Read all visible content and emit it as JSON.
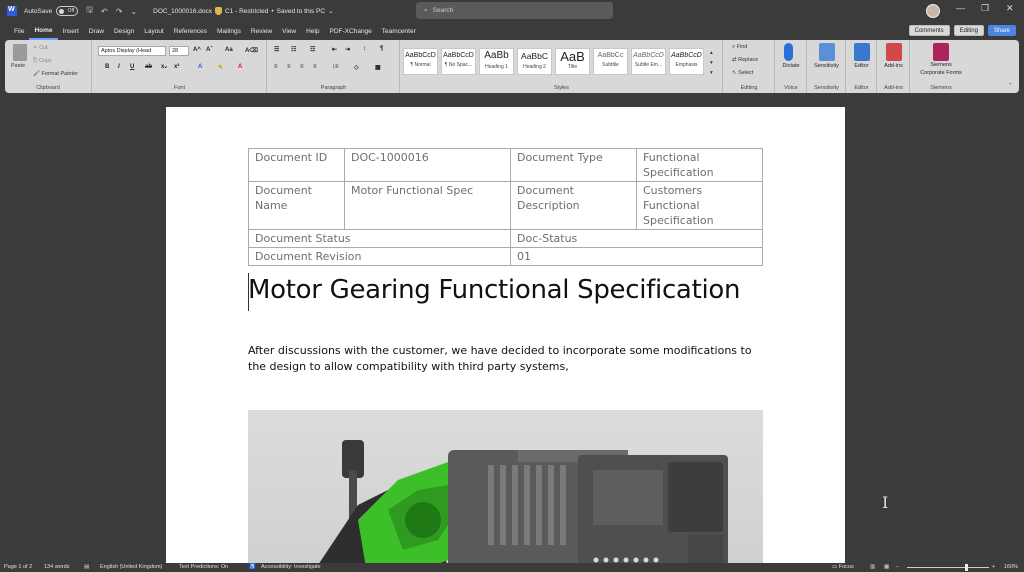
{
  "titlebar": {
    "autosave_label": "AutoSave",
    "autosave_state": "Off",
    "doc_name": "DOC_1000016.docx",
    "sensitivity": "C1 - Restricted",
    "save_status": "Saved to this PC",
    "search_placeholder": "Search"
  },
  "tabs": [
    "File",
    "Home",
    "Insert",
    "Draw",
    "Design",
    "Layout",
    "References",
    "Mailings",
    "Review",
    "View",
    "Help",
    "PDF-XChange",
    "Teamcenter"
  ],
  "ribbon_actions": {
    "comments": "Comments",
    "editing": "Editing",
    "share": "Share"
  },
  "ribbon": {
    "clipboard": {
      "paste": "Paste",
      "cut": "Cut",
      "copy": "Copy",
      "format_painter": "Format Painter",
      "label": "Clipboard"
    },
    "font": {
      "font_name": "Aptos Display (Head",
      "font_size": "28",
      "label": "Font"
    },
    "paragraph": {
      "label": "Paragraph"
    },
    "styles": {
      "label": "Styles",
      "items": [
        {
          "sample": "AaBbCcD",
          "name": "¶ Normal"
        },
        {
          "sample": "AaBbCcD",
          "name": "¶ No Spac..."
        },
        {
          "sample": "AaBb",
          "name": "Heading 1"
        },
        {
          "sample": "AaBbC",
          "name": "Heading 2"
        },
        {
          "sample": "AaB",
          "name": "Title"
        },
        {
          "sample": "AaBbCc",
          "name": "Subtitle"
        },
        {
          "sample": "AaBbCcD",
          "name": "Subtle Em..."
        },
        {
          "sample": "AaBbCcD",
          "name": "Emphasis"
        }
      ]
    },
    "editing": {
      "find": "Find",
      "replace": "Replace",
      "select": "Select",
      "label": "Editing"
    },
    "voice": {
      "dictate": "Dictate",
      "label": "Voice"
    },
    "sensitivity": {
      "button": "Sensitivity",
      "label": "Sensitivity"
    },
    "editor": {
      "button": "Editor",
      "label": "Editor"
    },
    "addins": {
      "button": "Add-ins",
      "label": "Add-ins"
    },
    "siemens": {
      "button_line1": "Siemens",
      "button_line2": "Corporate Forms",
      "label": "Siemens"
    }
  },
  "document": {
    "table": {
      "doc_id_label": "Document ID",
      "doc_id_value": "DOC-1000016",
      "doc_type_label": "Document Type",
      "doc_type_value": "Functional Specification",
      "doc_name_label": "Document Name",
      "doc_name_value": "Motor Functional Spec",
      "doc_desc_label": "Document Description",
      "doc_desc_value": "Customers Functional Specification",
      "doc_status_label": "Document Status",
      "doc_status_value": "Doc-Status",
      "doc_rev_label": "Document Revision",
      "doc_rev_value": "01"
    },
    "title": "Motor Gearing Functional Specification",
    "paragraph": "After discussions with the customer, we have decided to incorporate some modifications to the design to allow compatibility with third party systems,"
  },
  "statusbar": {
    "page": "Page 1 of 2",
    "words": "134 words",
    "language": "English (United Kingdom)",
    "text_predictions": "Text Predictions: On",
    "accessibility": "Accessibility: Investigate",
    "focus": "Focus",
    "zoom": "160%"
  },
  "colors": {
    "accent": "#2b5fd9",
    "gear_green": "#3dbf2a"
  }
}
